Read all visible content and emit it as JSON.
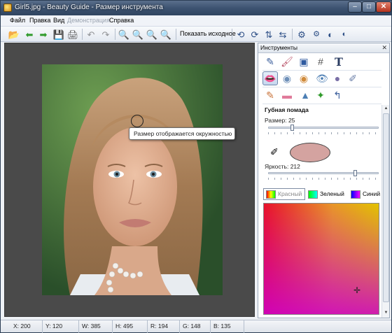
{
  "window": {
    "title": "Girl5.jpg - Beauty Guide - Размер инструмента"
  },
  "menu": {
    "file": "Файл",
    "edit": "Правка",
    "view": "Вид",
    "demo": "Демонстрация",
    "help": "Справка"
  },
  "toolbar": {
    "show_original": "Показать исходное"
  },
  "canvas": {
    "tooltip": "Размер отображается окружностью"
  },
  "panel": {
    "title": "Инструменты",
    "section": "Губная помада",
    "size_label": "Размер: 25",
    "size_value": 25,
    "brightness_label": "Яркость: 212",
    "brightness_value": 212,
    "swatch_color": "#d4a3a0",
    "color_tabs": [
      {
        "label": "Красный"
      },
      {
        "label": "Зеленый"
      },
      {
        "label": "Синий"
      }
    ]
  },
  "status": {
    "x": "X: 200",
    "y": "Y: 120",
    "w": "W: 385",
    "h": "H: 495",
    "r": "R: 194",
    "g": "G: 148",
    "b": "B: 135"
  }
}
